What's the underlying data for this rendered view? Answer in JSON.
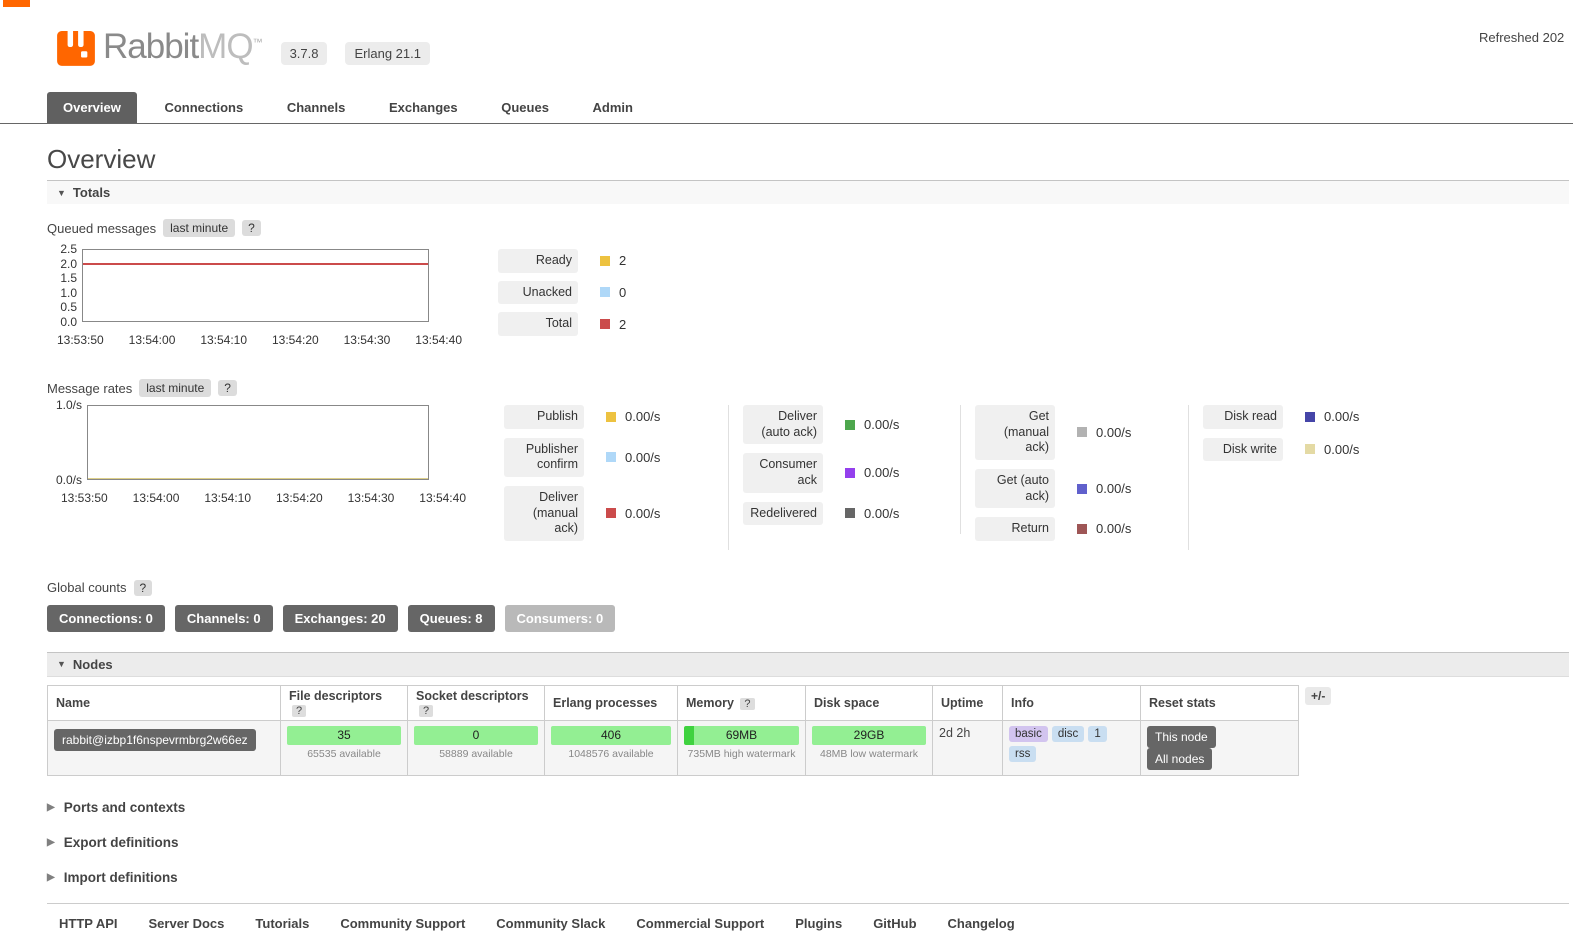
{
  "header": {
    "brand_primary": "Rabbit",
    "brand_secondary": "MQ",
    "brand_tm": "™",
    "version_badge": "3.7.8",
    "erlang_badge": "Erlang 21.1",
    "refreshed": "Refreshed 202"
  },
  "icons": {
    "expanded": "▼",
    "collapsed": "▶"
  },
  "nav": {
    "tabs": [
      {
        "label": "Overview",
        "active": true
      },
      {
        "label": "Connections",
        "active": false
      },
      {
        "label": "Channels",
        "active": false
      },
      {
        "label": "Exchanges",
        "active": false
      },
      {
        "label": "Queues",
        "active": false
      },
      {
        "label": "Admin",
        "active": false
      }
    ]
  },
  "page_title": "Overview",
  "sections": {
    "totals": "Totals",
    "nodes": "Nodes",
    "collapsed": [
      "Ports and contexts",
      "Export definitions",
      "Import definitions"
    ]
  },
  "queued_messages": {
    "label": "Queued messages",
    "period": "last minute",
    "help": "?",
    "legend": [
      {
        "label": "Ready",
        "color": "#edc240",
        "value": "2"
      },
      {
        "label": "Unacked",
        "color": "#afd8f8",
        "value": "0"
      },
      {
        "label": "Total",
        "color": "#cb4b4b",
        "value": "2"
      }
    ]
  },
  "message_rates": {
    "label": "Message rates",
    "period": "last minute",
    "help": "?",
    "columns": [
      {
        "items": [
          {
            "label": "Publish",
            "color": "#edc240",
            "value": "0.00/s"
          },
          {
            "label": "Publisher confirm",
            "color": "#afd8f8",
            "value": "0.00/s"
          },
          {
            "label": "Deliver (manual ack)",
            "color": "#cb4b4b",
            "value": "0.00/s"
          }
        ]
      },
      {
        "items": [
          {
            "label": "Deliver (auto ack)",
            "color": "#4da74d",
            "value": "0.00/s"
          },
          {
            "label": "Consumer ack",
            "color": "#9440ed",
            "value": "0.00/s"
          },
          {
            "label": "Redelivered",
            "color": "#666666",
            "value": "0.00/s"
          }
        ]
      },
      {
        "items": [
          {
            "label": "Get (manual ack)",
            "color": "#b2b2b2",
            "value": "0.00/s"
          },
          {
            "label": "Get (auto ack)",
            "color": "#6060cc",
            "value": "0.00/s"
          },
          {
            "label": "Return",
            "color": "#9e5656",
            "value": "0.00/s"
          }
        ]
      },
      {
        "items": [
          {
            "label": "Disk read",
            "color": "#4545a8",
            "value": "0.00/s"
          },
          {
            "label": "Disk write",
            "color": "#e4daa4",
            "value": "0.00/s"
          }
        ]
      }
    ]
  },
  "chart_data": [
    {
      "type": "line",
      "title": "Queued messages (last minute)",
      "x": [
        "13:53:50",
        "13:54:00",
        "13:54:10",
        "13:54:20",
        "13:54:30",
        "13:54:40"
      ],
      "ylim": [
        0,
        2.5
      ],
      "y_ticks": [
        "2.5",
        "2.0",
        "1.5",
        "1.0",
        "0.5",
        "0.0"
      ],
      "series": [
        {
          "name": "Ready",
          "color": "#edc240",
          "values": [
            2,
            2,
            2,
            2,
            2,
            2
          ]
        },
        {
          "name": "Unacked",
          "color": "#afd8f8",
          "values": [
            0,
            0,
            0,
            0,
            0,
            0
          ]
        },
        {
          "name": "Total",
          "color": "#cb4b4b",
          "values": [
            2,
            2,
            2,
            2,
            2,
            2
          ]
        }
      ]
    },
    {
      "type": "line",
      "title": "Message rates (last minute)",
      "x": [
        "13:53:50",
        "13:54:00",
        "13:54:10",
        "13:54:20",
        "13:54:30",
        "13:54:40"
      ],
      "ylim": [
        0,
        1
      ],
      "y_ticks": [
        "1.0/s",
        "0.0/s"
      ],
      "series": [
        {
          "name": "all rates",
          "values": [
            0,
            0,
            0,
            0,
            0,
            0
          ]
        }
      ]
    }
  ],
  "global_counts": {
    "label": "Global counts",
    "help": "?",
    "badges": [
      {
        "label": "Connections: 0",
        "muted": false
      },
      {
        "label": "Channels: 0",
        "muted": false
      },
      {
        "label": "Exchanges: 20",
        "muted": false
      },
      {
        "label": "Queues: 8",
        "muted": false
      },
      {
        "label": "Consumers: 0",
        "muted": true
      }
    ]
  },
  "nodes_table": {
    "headers": {
      "name": "Name",
      "file_descriptors": "File descriptors",
      "socket_descriptors": "Socket descriptors",
      "erlang_processes": "Erlang processes",
      "memory": "Memory",
      "disk_space": "Disk space",
      "uptime": "Uptime",
      "info": "Info",
      "reset_stats": "Reset stats",
      "help": "?"
    },
    "row": {
      "name": "rabbit@izbp1f6nspevrmbrg2w66ez",
      "file_descriptors": {
        "value": "35",
        "sub": "65535 available"
      },
      "socket_descriptors": {
        "value": "0",
        "sub": "58889 available"
      },
      "erlang_processes": {
        "value": "406",
        "sub": "1048576 available"
      },
      "memory": {
        "value": "69MB",
        "sub": "735MB high watermark"
      },
      "disk_space": {
        "value": "29GB",
        "sub": "48MB low watermark"
      },
      "uptime": "2d 2h",
      "info_badges": [
        "basic",
        "disc",
        "1",
        "rss"
      ],
      "reset_buttons": [
        "This node",
        "All nodes"
      ]
    },
    "plus_minus": "+/-"
  },
  "footer": {
    "links": [
      "HTTP API",
      "Server Docs",
      "Tutorials",
      "Community Support",
      "Community Slack",
      "Commercial Support",
      "Plugins",
      "GitHub",
      "Changelog"
    ]
  },
  "colors": {
    "accent": "#ff6600",
    "tab_active_bg": "#606060",
    "badge_dark_bg": "#666666",
    "bar_green": "#93ef93"
  }
}
